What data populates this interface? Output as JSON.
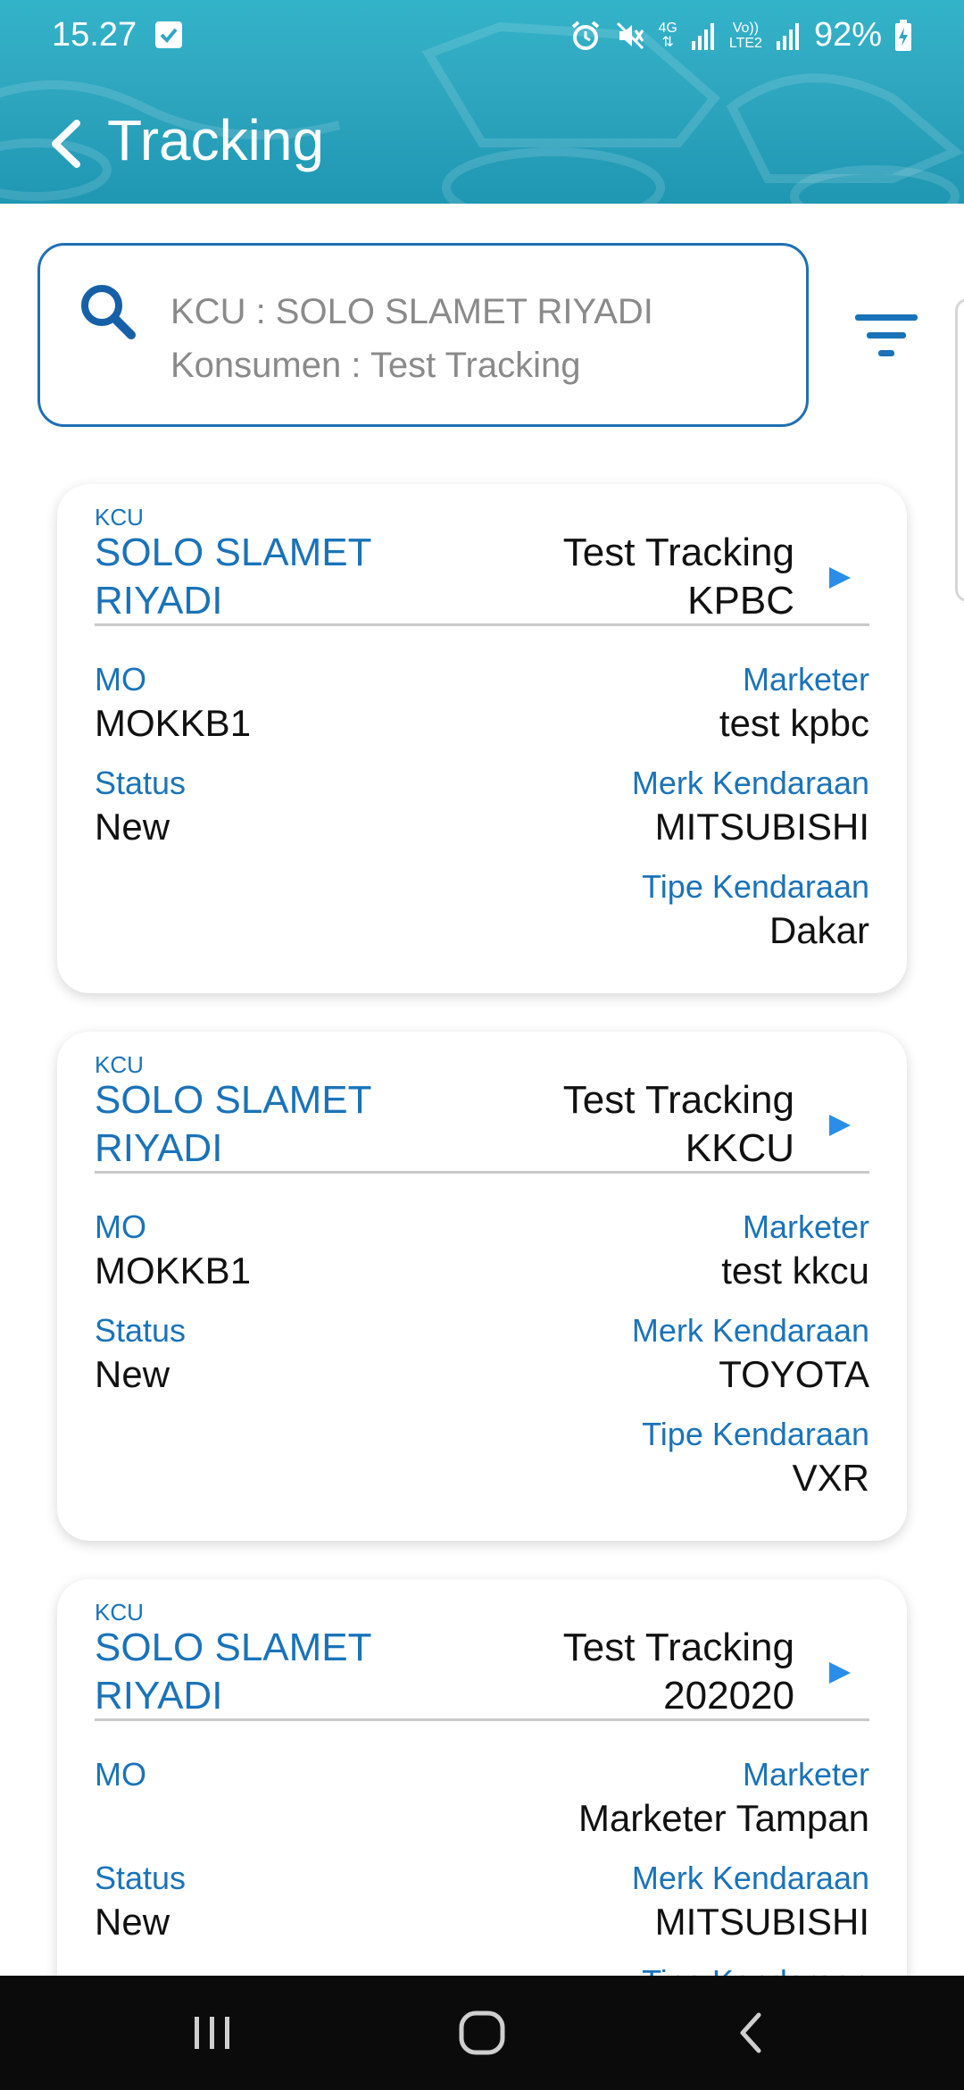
{
  "status_bar": {
    "time": "15.27",
    "net_4g": "4G",
    "volte_top": "Vo))",
    "volte_bottom": "LTE2",
    "battery": "92%"
  },
  "header": {
    "title": "Tracking"
  },
  "search": {
    "line1": "KCU : SOLO SLAMET RIYADI",
    "line2": "Konsumen : Test Tracking"
  },
  "labels": {
    "kcu": "KCU",
    "mo": "MO",
    "marketer": "Marketer",
    "status": "Status",
    "merk": "Merk Kendaraan",
    "tipe": "Tipe Kendaraan"
  },
  "cards": [
    {
      "kcu_line1": "SOLO SLAMET",
      "kcu_line2": "RIYADI",
      "name_line1": "Test Tracking",
      "name_line2": "KPBC",
      "mo": "MOKKB1",
      "marketer": "test kpbc",
      "status": "New",
      "merk": "MITSUBISHI",
      "tipe": "Dakar"
    },
    {
      "kcu_line1": "SOLO SLAMET",
      "kcu_line2": "RIYADI",
      "name_line1": "Test Tracking",
      "name_line2": "KKCU",
      "mo": "MOKKB1",
      "marketer": "test kkcu",
      "status": "New",
      "merk": "TOYOTA",
      "tipe": "VXR"
    },
    {
      "kcu_line1": "SOLO SLAMET",
      "kcu_line2": "RIYADI",
      "name_line1": "Test Tracking",
      "name_line2": "202020",
      "mo": "",
      "marketer": "Marketer Tampan",
      "status": "New",
      "merk": "MITSUBISHI",
      "tipe": "Tipe Kendaraan"
    }
  ],
  "icons": {
    "back": "chevron-left-icon",
    "search": "search-icon",
    "filter": "filter-icon",
    "card_arrow": "play-arrow-icon"
  },
  "colors": {
    "header_gradient_top": "#33b3c9",
    "header_gradient_bottom": "#1f97b3",
    "accent_blue": "#1a73b9",
    "arrow_blue": "#2a8ee8"
  }
}
